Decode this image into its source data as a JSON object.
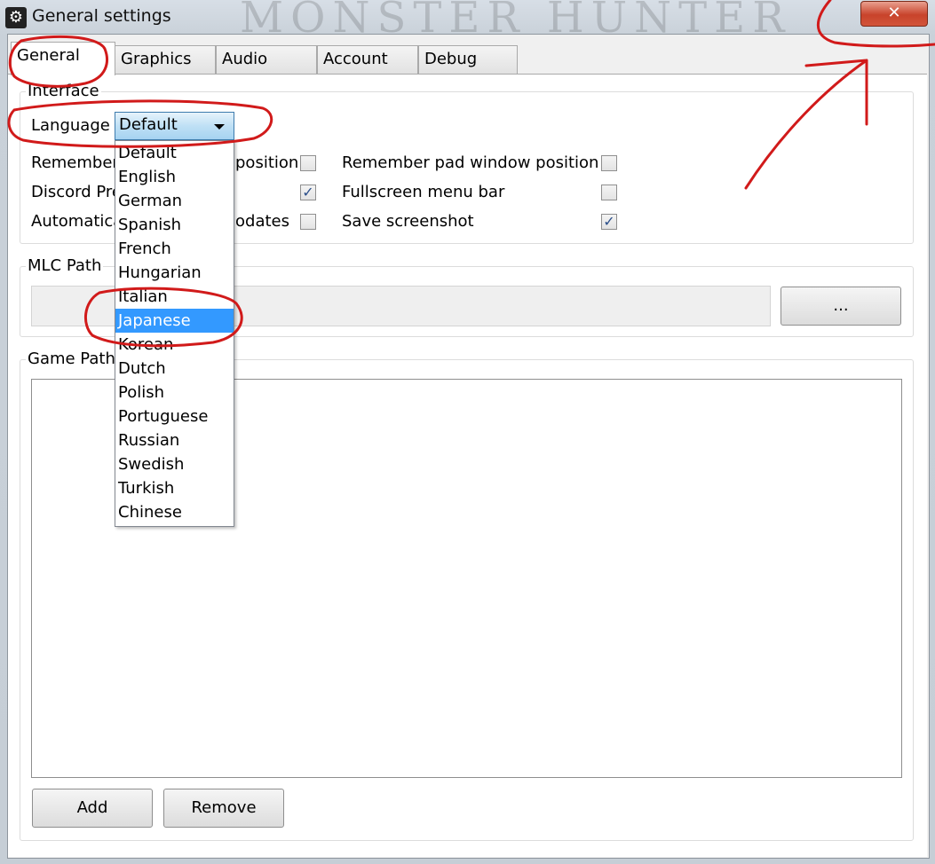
{
  "window": {
    "title": "General settings",
    "bg_text": "MONSTER HUNTER",
    "close_symbol": "✕"
  },
  "tabs": [
    "General",
    "Graphics",
    "Audio",
    "Account",
    "Debug"
  ],
  "interface": {
    "title": "Interface",
    "language_label": "Language",
    "language_value": "Default",
    "options": [
      "Remember",
      "Discord Pre",
      "Automatica"
    ],
    "options_right_fragments": [
      "position",
      "",
      "odates"
    ],
    "right_options": [
      "Remember pad window position",
      "Fullscreen menu bar",
      "Save screenshot"
    ]
  },
  "language_list": [
    "Default",
    "English",
    "German",
    "Spanish",
    "French",
    "Hungarian",
    "Italian",
    "Japanese",
    "Korean",
    "Dutch",
    "Polish",
    "Portuguese",
    "Russian",
    "Swedish",
    "Turkish",
    "Chinese"
  ],
  "language_selected": "Japanese",
  "mlc": {
    "title": "MLC Path",
    "browse_label": "..."
  },
  "game_paths": {
    "title": "Game Paths",
    "add_label": "Add",
    "remove_label": "Remove"
  },
  "colors": {
    "annotation": "#d11a1a",
    "selection": "#3399ff"
  }
}
